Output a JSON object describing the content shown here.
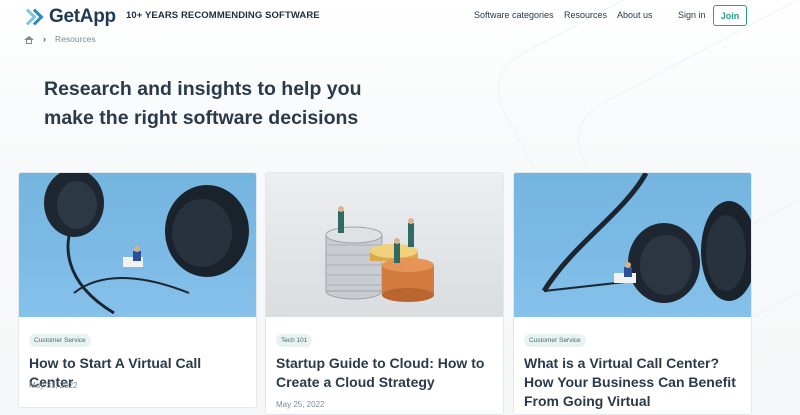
{
  "header": {
    "logo_text": "GetApp",
    "tagline": "10+ YEARS RECOMMENDING SOFTWARE",
    "nav": [
      {
        "label": "Software categories"
      },
      {
        "label": "Resources"
      },
      {
        "label": "About us"
      }
    ],
    "signin_label": "Sign in",
    "join_label": "Join"
  },
  "breadcrumb": {
    "home_icon": "home-icon",
    "separator": "›",
    "current": "Resources"
  },
  "hero": {
    "headline_line1": "Research and insights to help you",
    "headline_line2": "make the right software decisions"
  },
  "cards": [
    {
      "badge": "Customer Service",
      "title": "How to Start A Virtual Call Center",
      "date": "May 31, 2022",
      "image": "headset-on-blue-background"
    },
    {
      "badge": "Tech 101",
      "title": "Startup Guide to Cloud: How to Create a Cloud Strategy",
      "date": "May 25, 2022",
      "image": "miniature-figures-on-coin-stacks"
    },
    {
      "badge": "Customer Service",
      "title": "What is a Virtual Call Center? How Your Business Can Benefit From Going Virtual",
      "date": "",
      "image": "headset-on-blue-background"
    }
  ],
  "colors": {
    "accent": "#2a9d8f",
    "logo_blue": "#2a8bb4",
    "text": "#2b3a4a"
  }
}
